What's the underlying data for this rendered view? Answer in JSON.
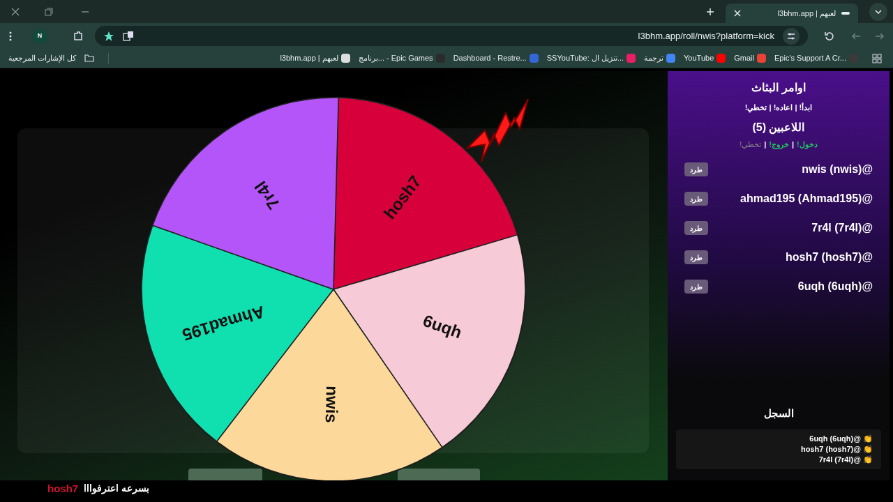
{
  "browser": {
    "tab_title": "l3bhm.app | لعبهم",
    "url": "l3bhm.app/roll/nwis?platform=kick",
    "profile_initial": "N",
    "all_bookmarks": "كل الإشارات المرجعية",
    "bookmarks": [
      {
        "label": "Epic's Support A Cr...",
        "color": "#3a3a3a"
      },
      {
        "label": "Gmail",
        "color": "#ea4335"
      },
      {
        "label": "YouTube",
        "color": "#ff0000"
      },
      {
        "label": "ترجمة",
        "color": "#4285f4"
      },
      {
        "label": "SSYouTube: تنزيل ال...",
        "color": "#e91e63"
      },
      {
        "label": "Dashboard - Restre...",
        "color": "#3367d6"
      },
      {
        "label": "برنامج... - Epic Games",
        "color": "#2b2b2b"
      },
      {
        "label": "l3bhm.app | لعبهم",
        "color": "#dddddd"
      }
    ]
  },
  "wheel": {
    "segments": [
      {
        "label": "hosh7",
        "color": "#d8003a"
      },
      {
        "label": "6uqh",
        "color": "#f7cad7"
      },
      {
        "label": "nwis",
        "color": "#fcd99a"
      },
      {
        "label": "Ahmad195",
        "color": "#10e0b0"
      },
      {
        "label": "7r4l",
        "color": "#b455fa"
      }
    ]
  },
  "panel": {
    "title": "اوامر البثاث",
    "streamer_commands": "ابدأ! | اعاده! | تخطي!",
    "players_title": "اللاعبين (5)",
    "separator": "|",
    "player_commands": [
      {
        "label": "دخول!",
        "enabled": true
      },
      {
        "label": "خروج!",
        "enabled": true
      },
      {
        "label": "تخطي!",
        "enabled": false
      }
    ],
    "players": [
      {
        "name": "@nwis (nwis)",
        "kick": "طرد"
      },
      {
        "name": "@ahmad195 (Ahmad195)",
        "kick": "طرد"
      },
      {
        "name": "@7r4l (7r4l)",
        "kick": "طرد"
      },
      {
        "name": "@hosh7 (hosh7)",
        "kick": "طرد"
      },
      {
        "name": "@6uqh (6uqh)",
        "kick": "طرد"
      }
    ],
    "log_title": "السجل",
    "log": [
      {
        "text": "👏 @6uqh (6uqh)"
      },
      {
        "text": "👏 @hosh7 (hosh7)"
      },
      {
        "text": "👏 @7r4l (7r4l)"
      }
    ]
  },
  "chat": {
    "user": "hosh7",
    "message": "بسرعه اعترفوااا"
  }
}
